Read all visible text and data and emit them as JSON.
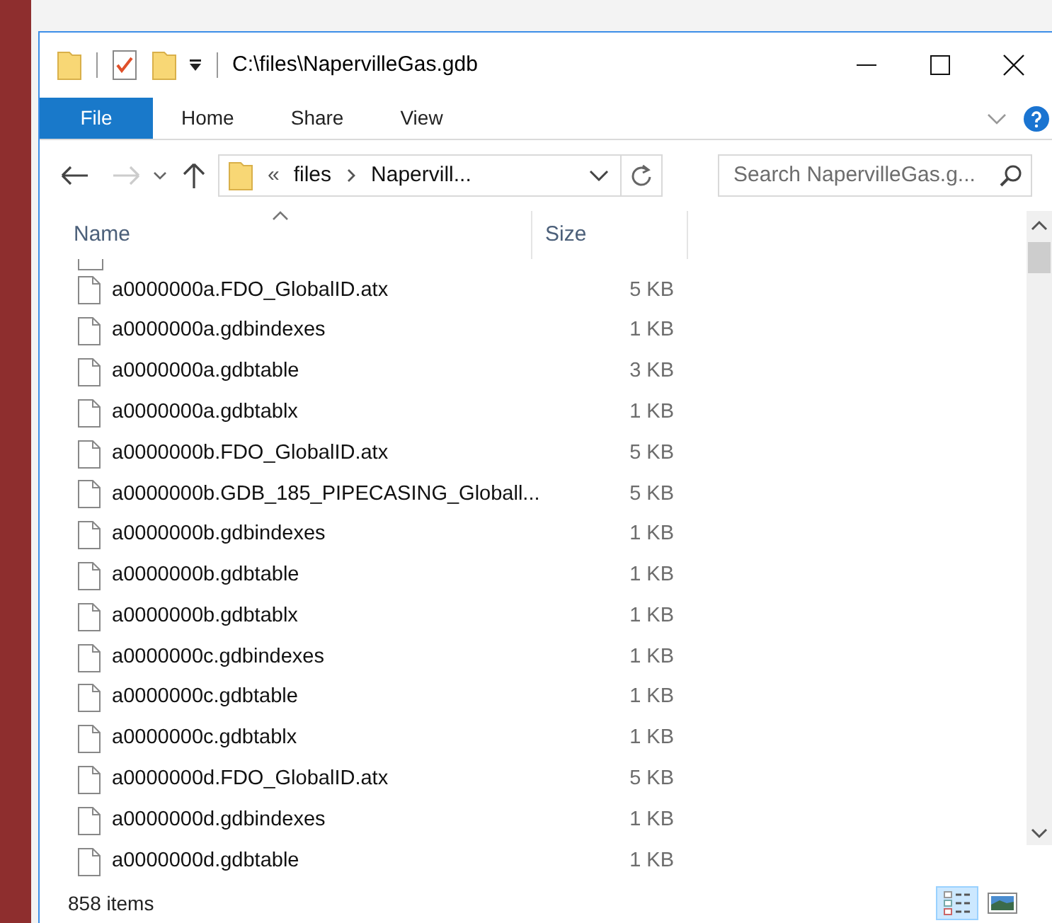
{
  "window": {
    "title": "C:\\files\\NapervilleGas.gdb"
  },
  "ribbon_tabs": [
    {
      "label": "File",
      "selected": true
    },
    {
      "label": "Home",
      "selected": false
    },
    {
      "label": "Share",
      "selected": false
    },
    {
      "label": "View",
      "selected": false
    }
  ],
  "address": {
    "overflow": "«",
    "crumbs": [
      "files",
      "Napervill..."
    ]
  },
  "search": {
    "placeholder": "Search NapervilleGas.g..."
  },
  "columns": [
    {
      "label": "Name",
      "sorted": true
    },
    {
      "label": "Size",
      "sorted": false
    }
  ],
  "rows": [
    {
      "name": "a0000000a.FDO_GlobalID.atx",
      "size": "5 KB"
    },
    {
      "name": "a0000000a.gdbindexes",
      "size": "1 KB"
    },
    {
      "name": "a0000000a.gdbtable",
      "size": "3 KB"
    },
    {
      "name": "a0000000a.gdbtablx",
      "size": "1 KB"
    },
    {
      "name": "a0000000b.FDO_GlobalID.atx",
      "size": "5 KB"
    },
    {
      "name": "a0000000b.GDB_185_PIPECASING_Globall...",
      "size": "5 KB"
    },
    {
      "name": "a0000000b.gdbindexes",
      "size": "1 KB"
    },
    {
      "name": "a0000000b.gdbtable",
      "size": "1 KB"
    },
    {
      "name": "a0000000b.gdbtablx",
      "size": "1 KB"
    },
    {
      "name": "a0000000c.gdbindexes",
      "size": "1 KB"
    },
    {
      "name": "a0000000c.gdbtable",
      "size": "1 KB"
    },
    {
      "name": "a0000000c.gdbtablx",
      "size": "1 KB"
    },
    {
      "name": "a0000000d.FDO_GlobalID.atx",
      "size": "5 KB"
    },
    {
      "name": "a0000000d.gdbindexes",
      "size": "1 KB"
    },
    {
      "name": "a0000000d.gdbtable",
      "size": "1 KB"
    }
  ],
  "status_bar": {
    "item_count": "858 items"
  },
  "views": [
    {
      "kind": "details",
      "selected": true
    },
    {
      "kind": "tiles",
      "selected": false
    }
  ]
}
